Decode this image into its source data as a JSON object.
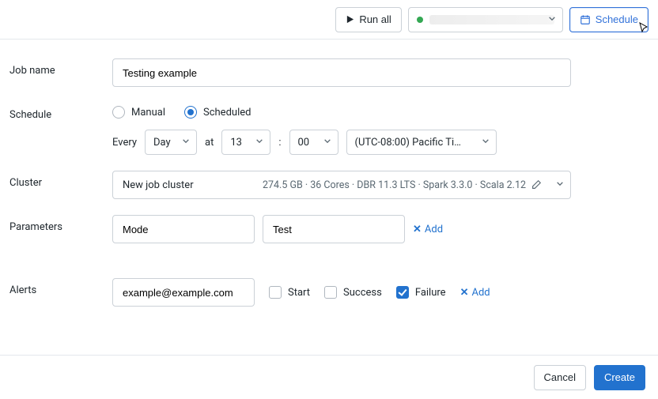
{
  "topbar": {
    "run_all_label": "Run all",
    "schedule_label": "Schedule"
  },
  "form": {
    "job_name_label": "Job name",
    "job_name_value": "Testing example",
    "schedule_label": "Schedule",
    "schedule_mode_manual": "Manual",
    "schedule_mode_scheduled": "Scheduled",
    "schedule_mode_selected": "Scheduled",
    "every_label": "Every",
    "every_unit": "Day",
    "at_label": "at",
    "hour": "13",
    "colon": ":",
    "minute": "00",
    "timezone": "(UTC-08:00) Pacific Ti…",
    "cluster_label": "Cluster",
    "cluster_name": "New job cluster",
    "cluster_meta": "274.5 GB · 36 Cores · DBR 11.3 LTS · Spark 3.3.0 · Scala 2.12",
    "parameters_label": "Parameters",
    "param_key": "Mode",
    "param_value": "Test",
    "param_add": "Add",
    "alerts_label": "Alerts",
    "alert_email": "example@example.com",
    "alert_start": "Start",
    "alert_success": "Success",
    "alert_failure": "Failure",
    "alert_failure_checked": true,
    "alert_add": "Add"
  },
  "footer": {
    "cancel": "Cancel",
    "create": "Create"
  }
}
